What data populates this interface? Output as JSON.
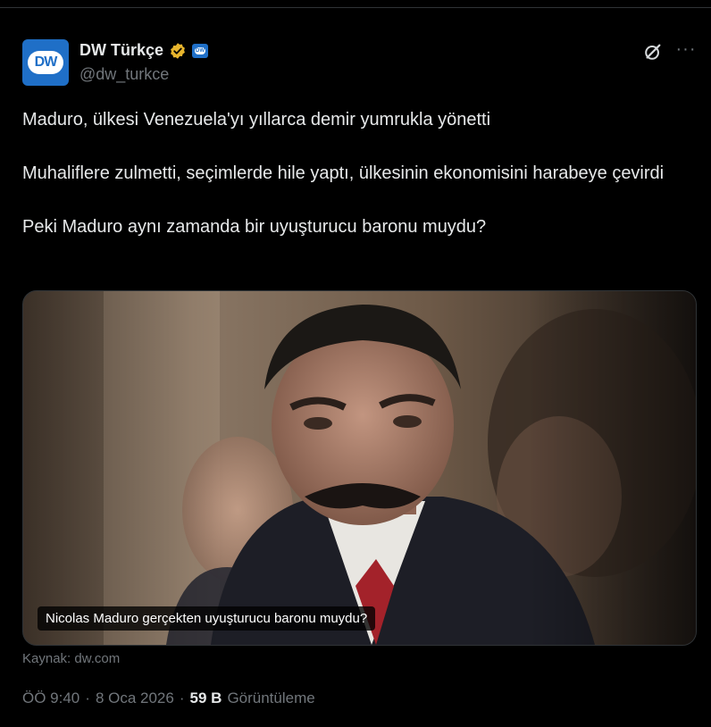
{
  "author": {
    "display_name": "DW Türkçe",
    "handle": "@dw_turkce",
    "avatar_text": "DW",
    "affiliate_badge_text": "DW",
    "brand_color": "#1f6fc7",
    "verified_color": "#e8b52d"
  },
  "actions": {
    "grok_icon": "grok-icon",
    "more_label": "···"
  },
  "tweet": {
    "line1": "Maduro, ülkesi Venezuela'yı yıllarca demir yumrukla yönetti",
    "line2": "Muhaliflere zulmetti, seçimlerde hile yaptı, ülkesinin ekonomisini harabeye çevirdi",
    "line3": "Peki Maduro aynı zamanda bir uyuşturucu baronu muydu?"
  },
  "card": {
    "caption": "Nicolas Maduro gerçekten uyuşturucu baronu muydu?",
    "source": "Kaynak: dw.com"
  },
  "meta": {
    "time": "ÖÖ 9:40",
    "sep1": "·",
    "date": "8 Oca 2026",
    "sep2": "·",
    "views_count": "59 B",
    "views_label": "Görüntüleme"
  }
}
